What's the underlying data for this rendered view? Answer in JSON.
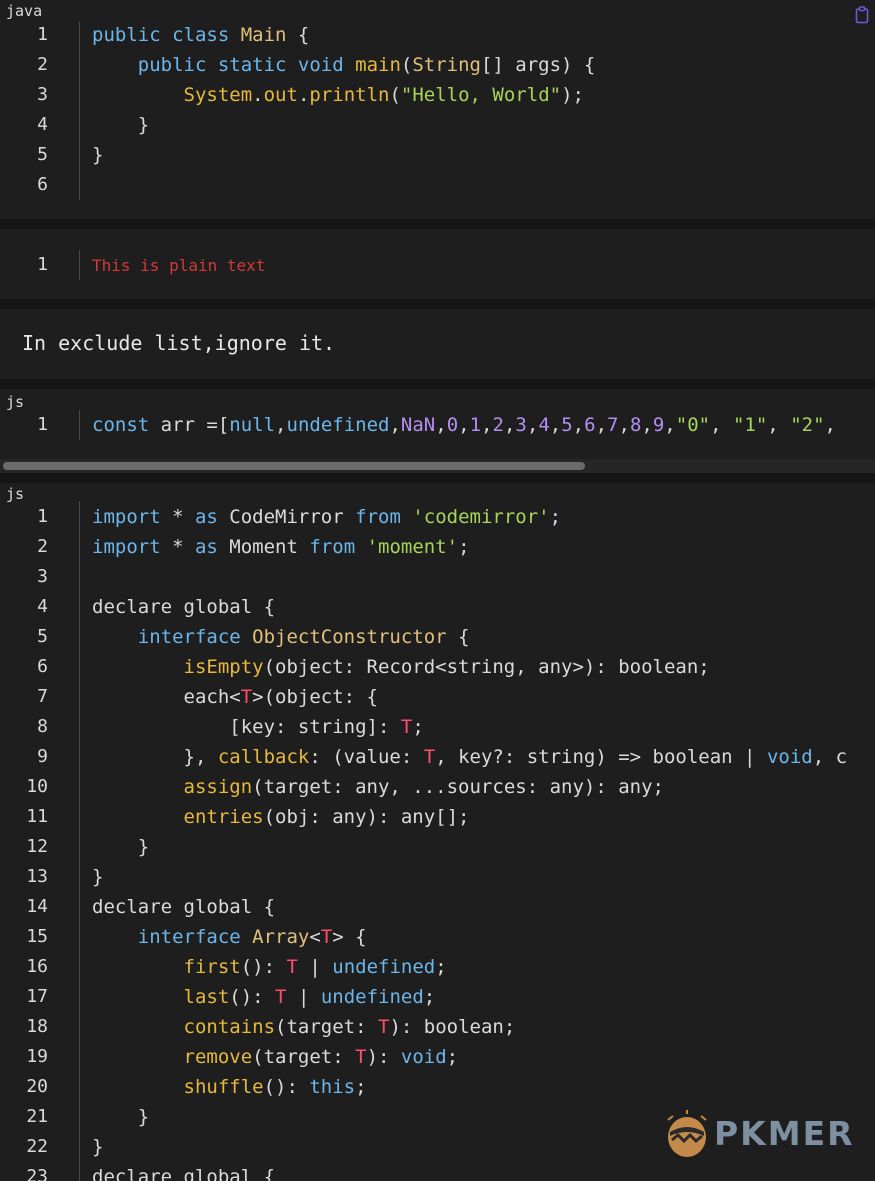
{
  "blocks": [
    {
      "lang": "java",
      "lines": [
        {
          "n": "1",
          "tokens": [
            [
              "kw",
              "public "
            ],
            [
              "kw",
              "class "
            ],
            [
              "ty",
              "Main "
            ],
            [
              "dc",
              "{"
            ]
          ]
        },
        {
          "n": "2",
          "tokens": [
            [
              "dc",
              "    "
            ],
            [
              "kw",
              "public "
            ],
            [
              "kw",
              "static "
            ],
            [
              "kw",
              "void "
            ],
            [
              "fn",
              "main"
            ],
            [
              "dc",
              "("
            ],
            [
              "ty",
              "String"
            ],
            [
              "dc",
              "[] args) {"
            ]
          ]
        },
        {
          "n": "3",
          "tokens": [
            [
              "dc",
              "        "
            ],
            [
              "fn",
              "System"
            ],
            [
              "dc",
              "."
            ],
            [
              "fn",
              "out"
            ],
            [
              "dc",
              "."
            ],
            [
              "fn",
              "println"
            ],
            [
              "dc",
              "("
            ],
            [
              "str",
              "\"Hello, World\""
            ],
            [
              "dc",
              ");"
            ]
          ]
        },
        {
          "n": "4",
          "tokens": [
            [
              "dc",
              "    }"
            ]
          ]
        },
        {
          "n": "5",
          "tokens": [
            [
              "dc",
              "}"
            ]
          ]
        },
        {
          "n": "6",
          "tokens": [
            [
              "dc",
              ""
            ]
          ]
        }
      ]
    },
    {
      "lang": "",
      "lines": [
        {
          "n": "1",
          "tokens": [
            [
              "plain-red",
              "This is plain text"
            ]
          ]
        }
      ]
    },
    {
      "note": "In exclude list,ignore it."
    },
    {
      "lang": "js",
      "lines": [
        {
          "n": "1",
          "tokens": [
            [
              "kw",
              "const "
            ],
            [
              "dc",
              "arr =["
            ],
            [
              "kw",
              "null"
            ],
            [
              "dc",
              ","
            ],
            [
              "kw",
              "undefined"
            ],
            [
              "dc",
              ","
            ],
            [
              "num",
              "NaN"
            ],
            [
              "dc",
              ","
            ],
            [
              "num",
              "0"
            ],
            [
              "dc",
              ","
            ],
            [
              "num",
              "1"
            ],
            [
              "dc",
              ","
            ],
            [
              "num",
              "2"
            ],
            [
              "dc",
              ","
            ],
            [
              "num",
              "3"
            ],
            [
              "dc",
              ","
            ],
            [
              "num",
              "4"
            ],
            [
              "dc",
              ","
            ],
            [
              "num",
              "5"
            ],
            [
              "dc",
              ","
            ],
            [
              "num",
              "6"
            ],
            [
              "dc",
              ","
            ],
            [
              "num",
              "7"
            ],
            [
              "dc",
              ","
            ],
            [
              "num",
              "8"
            ],
            [
              "dc",
              ","
            ],
            [
              "num",
              "9"
            ],
            [
              "dc",
              ","
            ],
            [
              "str",
              "\"0\""
            ],
            [
              "dc",
              ", "
            ],
            [
              "str",
              "\"1\""
            ],
            [
              "dc",
              ", "
            ],
            [
              "str",
              "\"2\""
            ],
            [
              "dc",
              ","
            ]
          ]
        }
      ]
    },
    {
      "lang": "js",
      "lines": [
        {
          "n": "1",
          "tokens": [
            [
              "kw",
              "import "
            ],
            [
              "dc",
              "* "
            ],
            [
              "kw",
              "as "
            ],
            [
              "dc",
              "CodeMirror "
            ],
            [
              "kw",
              "from "
            ],
            [
              "str",
              "'codemirror'"
            ],
            [
              "dc",
              ";"
            ]
          ]
        },
        {
          "n": "2",
          "tokens": [
            [
              "kw",
              "import "
            ],
            [
              "dc",
              "* "
            ],
            [
              "kw",
              "as "
            ],
            [
              "dc",
              "Moment "
            ],
            [
              "kw",
              "from "
            ],
            [
              "str",
              "'moment'"
            ],
            [
              "dc",
              ";"
            ]
          ]
        },
        {
          "n": "3",
          "tokens": [
            [
              "dc",
              ""
            ]
          ]
        },
        {
          "n": "4",
          "tokens": [
            [
              "dc",
              "declare global {"
            ]
          ]
        },
        {
          "n": "5",
          "tokens": [
            [
              "dc",
              "    "
            ],
            [
              "kw",
              "interface "
            ],
            [
              "ty",
              "ObjectConstructor "
            ],
            [
              "dc",
              "{"
            ]
          ]
        },
        {
          "n": "6",
          "tokens": [
            [
              "dc",
              "        "
            ],
            [
              "fn",
              "isEmpty"
            ],
            [
              "dc",
              "(object: Record<string, any>): boolean;"
            ]
          ]
        },
        {
          "n": "7",
          "tokens": [
            [
              "dc",
              "        each<"
            ],
            [
              "tp",
              "T"
            ],
            [
              "dc",
              ">(object: {"
            ]
          ]
        },
        {
          "n": "8",
          "tokens": [
            [
              "dc",
              "            [key: string]: "
            ],
            [
              "tp",
              "T"
            ],
            [
              "dc",
              ";"
            ]
          ]
        },
        {
          "n": "9",
          "tokens": [
            [
              "dc",
              "        }, "
            ],
            [
              "fn",
              "callback"
            ],
            [
              "dc",
              ": (value: "
            ],
            [
              "tp",
              "T"
            ],
            [
              "dc",
              ", key?: string) => boolean | "
            ],
            [
              "kw",
              "void"
            ],
            [
              "dc",
              ", c"
            ]
          ]
        },
        {
          "n": "10",
          "tokens": [
            [
              "dc",
              "        "
            ],
            [
              "fn",
              "assign"
            ],
            [
              "dc",
              "(target: any, ...sources: any): any;"
            ]
          ]
        },
        {
          "n": "11",
          "tokens": [
            [
              "dc",
              "        "
            ],
            [
              "fn",
              "entries"
            ],
            [
              "dc",
              "(obj: any): any[];"
            ]
          ]
        },
        {
          "n": "12",
          "tokens": [
            [
              "dc",
              "    }"
            ]
          ]
        },
        {
          "n": "13",
          "tokens": [
            [
              "dc",
              "}"
            ]
          ]
        },
        {
          "n": "14",
          "tokens": [
            [
              "dc",
              "declare global {"
            ]
          ]
        },
        {
          "n": "15",
          "tokens": [
            [
              "dc",
              "    "
            ],
            [
              "kw",
              "interface "
            ],
            [
              "ty",
              "Array"
            ],
            [
              "dc",
              "<"
            ],
            [
              "tp",
              "T"
            ],
            [
              "dc",
              "> {"
            ]
          ]
        },
        {
          "n": "16",
          "tokens": [
            [
              "dc",
              "        "
            ],
            [
              "fn",
              "first"
            ],
            [
              "dc",
              "(): "
            ],
            [
              "tp",
              "T"
            ],
            [
              "dc",
              " | "
            ],
            [
              "kw",
              "undefined"
            ],
            [
              "dc",
              ";"
            ]
          ]
        },
        {
          "n": "17",
          "tokens": [
            [
              "dc",
              "        "
            ],
            [
              "fn",
              "last"
            ],
            [
              "dc",
              "(): "
            ],
            [
              "tp",
              "T"
            ],
            [
              "dc",
              " | "
            ],
            [
              "kw",
              "undefined"
            ],
            [
              "dc",
              ";"
            ]
          ]
        },
        {
          "n": "18",
          "tokens": [
            [
              "dc",
              "        "
            ],
            [
              "fn",
              "contains"
            ],
            [
              "dc",
              "(target: "
            ],
            [
              "tp",
              "T"
            ],
            [
              "dc",
              "): boolean;"
            ]
          ]
        },
        {
          "n": "19",
          "tokens": [
            [
              "dc",
              "        "
            ],
            [
              "fn",
              "remove"
            ],
            [
              "dc",
              "(target: "
            ],
            [
              "tp",
              "T"
            ],
            [
              "dc",
              "): "
            ],
            [
              "kw",
              "void"
            ],
            [
              "dc",
              ";"
            ]
          ]
        },
        {
          "n": "20",
          "tokens": [
            [
              "dc",
              "        "
            ],
            [
              "fn",
              "shuffle"
            ],
            [
              "dc",
              "(): "
            ],
            [
              "kw",
              "this"
            ],
            [
              "dc",
              ";"
            ]
          ]
        },
        {
          "n": "21",
          "tokens": [
            [
              "dc",
              "    }"
            ]
          ]
        },
        {
          "n": "22",
          "tokens": [
            [
              "dc",
              "}"
            ]
          ]
        },
        {
          "n": "23",
          "tokens": [
            [
              "dc",
              "declare global {"
            ]
          ]
        }
      ]
    }
  ],
  "logo": {
    "text": "PKMER"
  },
  "icons": {
    "copy": "clipboard-icon"
  }
}
